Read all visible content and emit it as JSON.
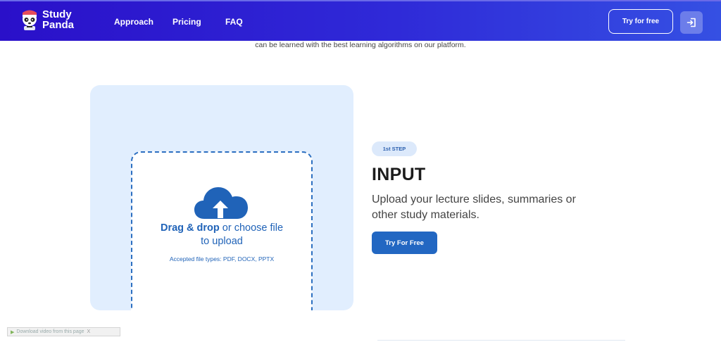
{
  "brand": {
    "name_line1": "Study",
    "name_line2": "Panda"
  },
  "nav": {
    "links": [
      "Approach",
      "Pricing",
      "FAQ"
    ],
    "try_label": "Try for free",
    "login_icon": "login-arrow-icon"
  },
  "intro": {
    "text": "can be learned with the best learning algorithms on our platform."
  },
  "upload": {
    "drag_bold": "Drag & drop",
    "drag_rest": " or choose file",
    "drag_line2": "to upload",
    "accepted": "Accepted file types: PDF, DOCX, PPTX",
    "icon": "cloud-upload-icon"
  },
  "step": {
    "badge": "1st STEP",
    "title": "INPUT",
    "description": "Upload your lecture slides, summaries or other study materials.",
    "cta_label": "Try For Free"
  },
  "video_bar": {
    "label": "Download video from this page",
    "controls": "X"
  },
  "colors": {
    "nav_start": "#2a10c9",
    "nav_end": "#3550e3",
    "accent": "#2267c2",
    "card_bg": "#e1eefe"
  }
}
